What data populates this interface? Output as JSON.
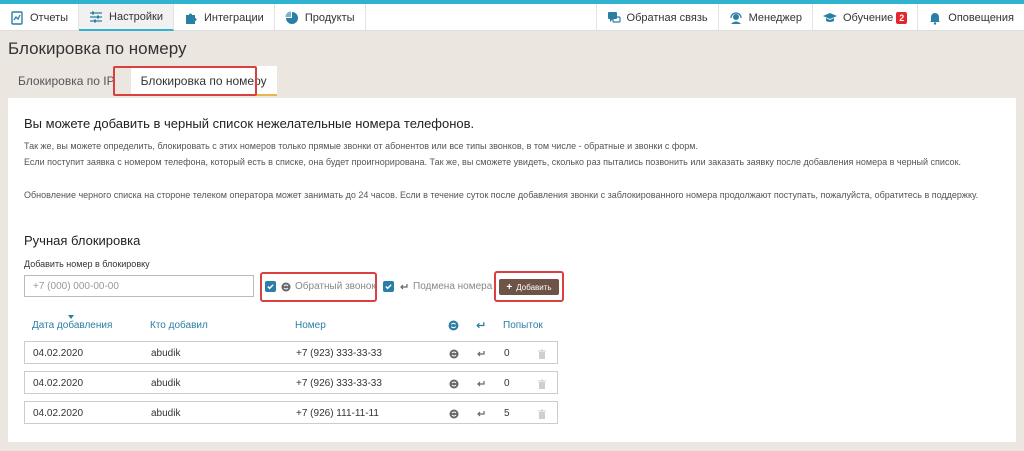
{
  "nav": {
    "left": [
      {
        "label": "Отчеты",
        "icon": "reports-icon"
      },
      {
        "label": "Настройки",
        "icon": "settings-sliders-icon"
      },
      {
        "label": "Интеграции",
        "icon": "puzzle-icon"
      },
      {
        "label": "Продукты",
        "icon": "pie-icon"
      }
    ],
    "right": [
      {
        "label": "Обратная связь",
        "icon": "feedback-icon"
      },
      {
        "label": "Менеджер",
        "icon": "headset-icon"
      },
      {
        "label": "Обучение",
        "icon": "graduation-cap-icon",
        "badge": "2"
      },
      {
        "label": "Оповещения",
        "icon": "bell-icon"
      }
    ]
  },
  "page": {
    "title": "Блокировка по номеру"
  },
  "tabs": [
    {
      "label": "Блокировка по IP"
    },
    {
      "label": "Блокировка по номеру"
    }
  ],
  "content": {
    "heading": "Вы можете добавить в черный список нежелательные номера телефонов.",
    "p1": "Так же, вы можете определить, блокировать с этих номеров только прямые звонки от абонентов или все типы звонков, в том числе - обратные и звонки с форм.",
    "p2": "Если поступит заявка с номером телефона, который есть в списке, она будет проигнорирована. Так же, вы сможете увидеть, сколько раз пытались позвонить или заказать заявку после добавления номера в черный список.",
    "p3": "Обновление черного списка на стороне телеком оператора может занимать до 24 часов. Если в течение суток после добавления звонки с заблокированного номера продолжают поступать, пожалуйста, обратитесь в поддержку."
  },
  "manual": {
    "title": "Ручная блокировка",
    "field_label": "Добавить номер в блокировку",
    "placeholder": "+7 (000) 000-00-00",
    "callback_label": "Обратный звонок",
    "spoof_label": "Подмена номера",
    "add_label": "Добавить"
  },
  "table": {
    "headers": {
      "date": "Дата добавления",
      "who": "Кто добавил",
      "number": "Номер",
      "attempts": "Попыток"
    },
    "rows": [
      {
        "date": "04.02.2020",
        "who": "abudik",
        "number": "+7 (923) 333-33-33",
        "attempts": "0"
      },
      {
        "date": "04.02.2020",
        "who": "abudik",
        "number": "+7 (926) 333-33-33",
        "attempts": "0"
      },
      {
        "date": "04.02.2020",
        "who": "abudik",
        "number": "+7 (926) 111-11-11",
        "attempts": "5"
      }
    ]
  },
  "colors": {
    "accent": "#2fb3cf",
    "link": "#2a7fa6",
    "highlight": "#d9403f",
    "add_button": "#6d5447",
    "badge": "#e3262e"
  }
}
